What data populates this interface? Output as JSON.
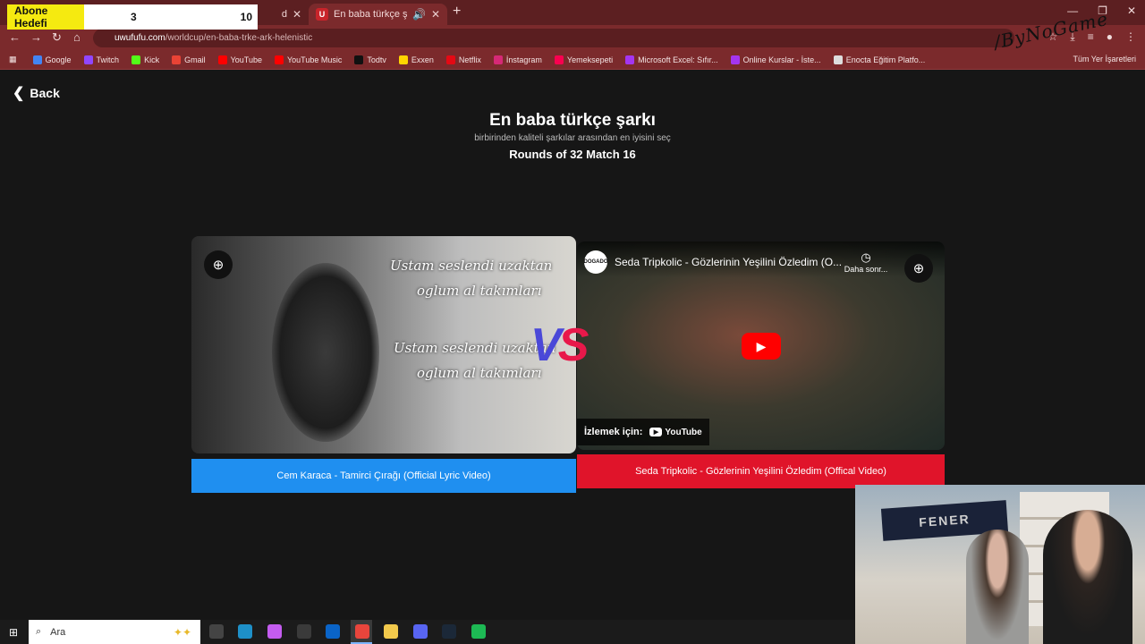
{
  "overlay": {
    "label": "Abone Hedefi",
    "current": "3",
    "goal": "10"
  },
  "browser": {
    "tabs": [
      {
        "title": "d",
        "active": false
      },
      {
        "title": "En baba türkçe şarkı | UwUf",
        "active": true,
        "favicon": "U"
      }
    ],
    "new_tab": "+",
    "url_host": "uwufufu.com",
    "url_path": "/worldcup/en-baba-trke-ark-helenistic",
    "bookmarks": [
      {
        "label": "Google",
        "color": "#4285f4"
      },
      {
        "label": "Twitch",
        "color": "#9146ff"
      },
      {
        "label": "Kick",
        "color": "#53fc18"
      },
      {
        "label": "Gmail",
        "color": "#ea4335"
      },
      {
        "label": "YouTube",
        "color": "#ff0000"
      },
      {
        "label": "YouTube Music",
        "color": "#ff0000"
      },
      {
        "label": "Todtv",
        "color": "#111111"
      },
      {
        "label": "Exxen",
        "color": "#ffd400"
      },
      {
        "label": "Netflix",
        "color": "#e50914"
      },
      {
        "label": "İnstagram",
        "color": "#d62976"
      },
      {
        "label": "Yemeksepeti",
        "color": "#fa0050"
      },
      {
        "label": "Microsoft Excel: Sıfır...",
        "color": "#a435f0"
      },
      {
        "label": "Online Kurslar - İste...",
        "color": "#a435f0"
      },
      {
        "label": "Enocta Eğitim Platfo...",
        "color": "#dddddd"
      }
    ],
    "all_bookmarks": "Tüm Yer İşaretleri",
    "watermark": "/ByNoGame"
  },
  "page": {
    "back_label": "Back",
    "title": "En baba türkçe şarkı",
    "subtitle": "birbirinden kaliteli şarkılar arasından en iyisini seç",
    "round": "Rounds of 32 Match 16",
    "vs_v": "V",
    "vs_s": "S",
    "left": {
      "lyric_1": "Ustam seslendi uzaktan",
      "lyric_2": "oglum al takımları",
      "lyric_3": "Ustam seslendi uzaktan",
      "lyric_4": "oglum al takımları",
      "button": "Cem Karaca - Tamirci Çırağı (Official Lyric Video)"
    },
    "right": {
      "video_title": "Seda Tripkolic - Gözlerinin Yeşilini Özledim (O...",
      "channel_avatar": "DOGADO",
      "watch_later": "Daha sonr...",
      "watch_on": "İzlemek için:",
      "youtube": "YouTube",
      "button": "Seda Tripkolic - Gözlerinin Yeşilini Özledim (Offical Video)"
    }
  },
  "webcam": {
    "scarf_text": "FENER"
  },
  "taskbar": {
    "search_placeholder": "Ara",
    "apps": [
      {
        "name": "task-view",
        "color": "#444444"
      },
      {
        "name": "edge",
        "color": "#1e90c8"
      },
      {
        "name": "copilot",
        "color": "#c45cf0"
      },
      {
        "name": "store",
        "color": "#3a3a3a"
      },
      {
        "name": "outlook",
        "color": "#0a64c8"
      },
      {
        "name": "chrome",
        "color": "#e8453c"
      },
      {
        "name": "explorer",
        "color": "#f2c94c"
      },
      {
        "name": "discord",
        "color": "#5865f2"
      },
      {
        "name": "steam",
        "color": "#1b2838"
      },
      {
        "name": "spotify",
        "color": "#1db954"
      }
    ]
  }
}
